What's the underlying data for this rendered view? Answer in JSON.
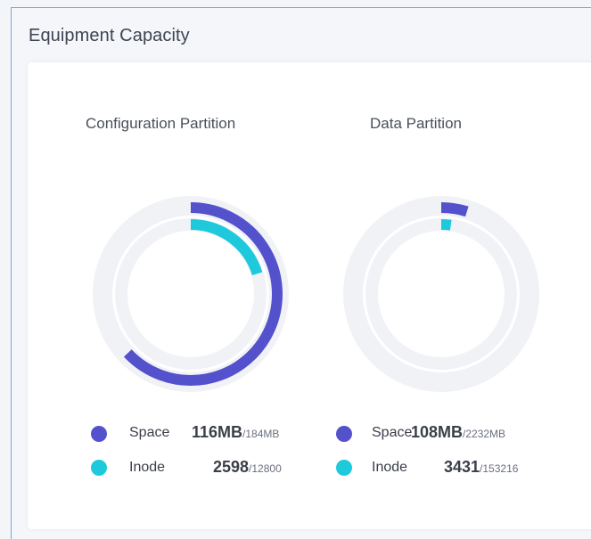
{
  "panel": {
    "title": "Equipment Capacity"
  },
  "colors": {
    "space": "#5451cc",
    "inode": "#1ec9dc",
    "track": "#f1f2f6",
    "inner_track": "#f1f2f6"
  },
  "partitions": [
    {
      "title": "Configuration Partition",
      "space": {
        "label": "Space",
        "used": "116MB",
        "total": "/184MB",
        "fraction": 0.63
      },
      "inode": {
        "label": "Inode",
        "used": "2598",
        "total": "/12800",
        "fraction": 0.203
      }
    },
    {
      "title": "Data Partition",
      "space": {
        "label": "Space",
        "used": "108MB",
        "total": "/2232MB",
        "fraction": 0.048
      },
      "inode": {
        "label": "Inode",
        "used": "3431",
        "total": "/153216",
        "fraction": 0.022
      }
    }
  ]
}
